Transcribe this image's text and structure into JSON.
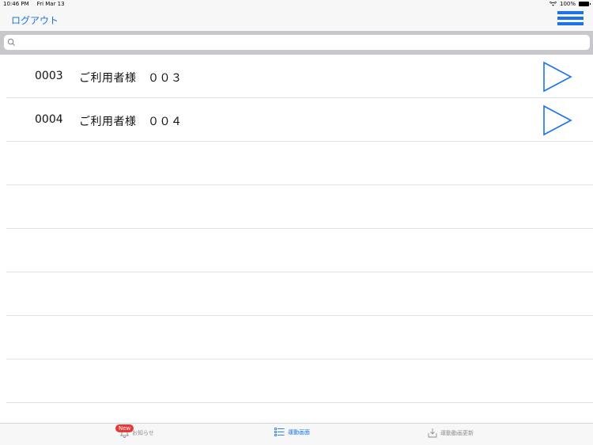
{
  "status_bar": {
    "time": "10:46 PM",
    "date": "Fri Mar 13",
    "battery": "100%"
  },
  "nav": {
    "logout_label": "ログアウト",
    "menu_icon": "hamburger-menu-icon"
  },
  "search": {
    "placeholder": ""
  },
  "rows": [
    {
      "code": "0003",
      "name": "ご利用者様　００３"
    },
    {
      "code": "0004",
      "name": "ご利用者様　００４"
    }
  ],
  "tabbar": {
    "badge": "New",
    "news_label": "お知らせ",
    "exercise_label": "運動画面",
    "update_label": "運動動画更新"
  },
  "colors": {
    "accent": "#1a73e8",
    "badge": "#e53935"
  }
}
